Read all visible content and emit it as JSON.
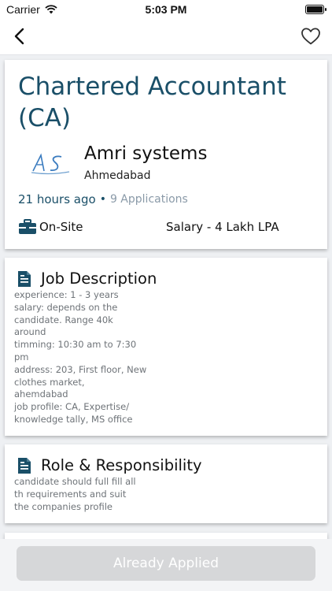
{
  "status_bar": {
    "carrier": "Carrier",
    "time": "5:03 PM"
  },
  "nav": {
    "back_icon": "chevron-left-icon",
    "favorite_icon": "heart-outline-icon"
  },
  "job": {
    "title": "Chartered Accountant (CA)",
    "company": "Amri systems",
    "location": "Ahmedabad",
    "posted": "21 hours ago",
    "separator": "•",
    "applications": "9 Applications",
    "work_type": "On-Site",
    "salary": "Salary - 4 Lakh LPA"
  },
  "description": {
    "heading": "Job Description",
    "lines": [
      "experience: 1 - 3 years",
      "salary: depends on the",
      "candidate. Range 40k",
      "around",
      "timming: 10:30 am to 7:30",
      "pm",
      "address: 203, First floor, New",
      "clothes market,",
      "ahemdabad",
      "job profile: CA, Expertise/",
      "knowledge tally, MS office"
    ]
  },
  "role": {
    "heading": "Role & Responsibility",
    "lines": [
      "candidate should full fill all",
      "th requirements and suit",
      "the companies profile"
    ]
  },
  "footer": {
    "button_label": "Already Applied"
  },
  "colors": {
    "accent": "#1a4f68",
    "muted": "#8a9aa8",
    "disabled_button": "#d6d7d9"
  }
}
